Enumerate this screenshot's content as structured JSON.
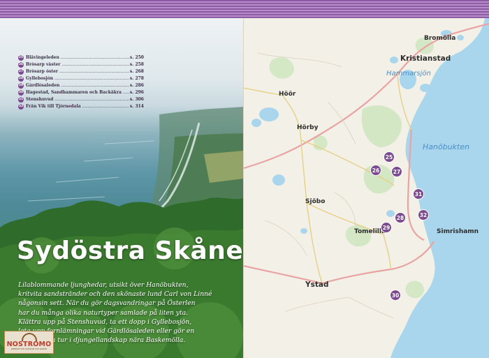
{
  "theme": {
    "accent": "#7b4a91",
    "stripe_light": "#b48cc6",
    "sea": "#a9d6ec",
    "land": "#f3f1e7"
  },
  "toc": [
    {
      "num": "25",
      "name": "Blåvingeleden",
      "page": "s. 250"
    },
    {
      "num": "26",
      "name": "Brösarp väster",
      "page": "s. 258"
    },
    {
      "num": "27",
      "name": "Brösarp öster",
      "page": "s. 268"
    },
    {
      "num": "28",
      "name": "Gyllebosjön",
      "page": "s. 278"
    },
    {
      "num": "29",
      "name": "Gärdlösaleden",
      "page": "s. 286"
    },
    {
      "num": "30",
      "name": "Hagestad, Sandhammaren och Backåkra",
      "page": "s. 296"
    },
    {
      "num": "31",
      "name": "Stenshuvud",
      "page": "s. 306"
    },
    {
      "num": "32",
      "name": "Från Vik till Tjörnedala",
      "page": "s. 314"
    }
  ],
  "region_title": "Sydöstra Skåne",
  "intro_lines": [
    "Lilablommande ljunghedar, utsikt över Hanöbukten,",
    "kritvita sandstränder och den skönaste lund Carl von Linné",
    "någonsin sett. När du gör dagsvandringar på Österlen",
    "har du många olika naturtyper samlade på liten yta.",
    "Klättra upp på Stenshuvud, ta ett dopp i Gyllebosjön,",
    "leta upp fornlämningar vid Gärdlösaleden eller gör en",
    "annorlunda tur i djungellandskap nära Baskemölla."
  ],
  "logo": {
    "name": "NOSTROMO",
    "tagline": "WEBSHOP FÖR OUTDOOR OCH KARTOR"
  },
  "map": {
    "places": {
      "bromolla": "Bromölla",
      "kristianstad": "Kristianstad",
      "hoor": "Höör",
      "horby": "Hörby",
      "sjobo": "Sjöbo",
      "tomelilla": "Tomelilla",
      "simrishamn": "Simrishamn",
      "ystad": "Ystad"
    },
    "waters": {
      "hammarsjon": "Hammarsjön",
      "hanobukten": "Hanöbukten"
    },
    "markers": [
      "25",
      "26",
      "27",
      "31",
      "32",
      "28",
      "29",
      "30"
    ]
  }
}
